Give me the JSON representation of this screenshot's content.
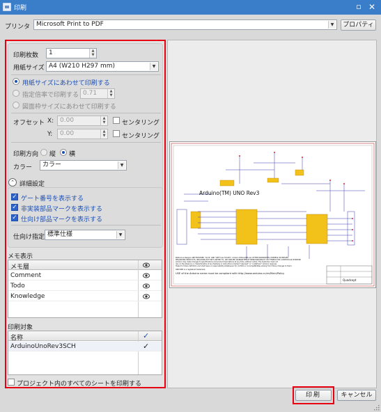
{
  "window": {
    "title": "印刷"
  },
  "printer": {
    "label": "プリンタ",
    "selected": "Microsoft Print to PDF",
    "properties_button": "プロパティ"
  },
  "settings": {
    "copies_label": "印刷枚数",
    "copies_value": "1",
    "paper_label": "用紙サイズ",
    "paper_value": "A4 (W210 H297 mm)",
    "fit_paper": "用紙サイズにあわせて印刷する",
    "scale_label": "指定倍率で印刷する",
    "scale_value": "0.71",
    "fit_frame": "図面枠サイズにあわせて印刷する",
    "offset_label": "オフセット",
    "offset_x_label": "X:",
    "offset_x_value": "0.00",
    "offset_y_label": "Y:",
    "offset_y_value": "0.00",
    "center_label": "センタリング",
    "orientation_label": "印刷方向",
    "orientation_portrait": "縦",
    "orientation_landscape": "横",
    "color_label": "カラー",
    "color_value": "カラー"
  },
  "details": {
    "header": "詳細設定",
    "gate_number": "ゲート番号を表示する",
    "unmounted_mark": "非実装部品マークを表示する",
    "dest_mark": "仕向け部品マークを表示する",
    "dest_label": "仕向け指定",
    "dest_value": "標準仕様"
  },
  "memo": {
    "section_label": "メモ表示",
    "column": "メモ層",
    "rows": [
      "Comment",
      "Todo",
      "Knowledge"
    ]
  },
  "target": {
    "section_label": "印刷対象",
    "column": "名称",
    "rows": [
      "ArduinoUnoRev3SCH"
    ]
  },
  "all_sheets": "プロジェクト内のすべてのシートを印刷する",
  "preview": {
    "schematic_title": "Arduino(TM) UNO Rev3",
    "footer_line": "USE of the Arduino name must be compliant with http://www.arduino.cc/en/Main/Policy",
    "titleblock_company": "Quadcept"
  },
  "buttons": {
    "print": "印刷",
    "cancel": "キャンセル"
  },
  "colors": {
    "highlight": "#e60012",
    "title_bar": "#3a7dc9",
    "accent_blue": "#1a4fb8"
  }
}
